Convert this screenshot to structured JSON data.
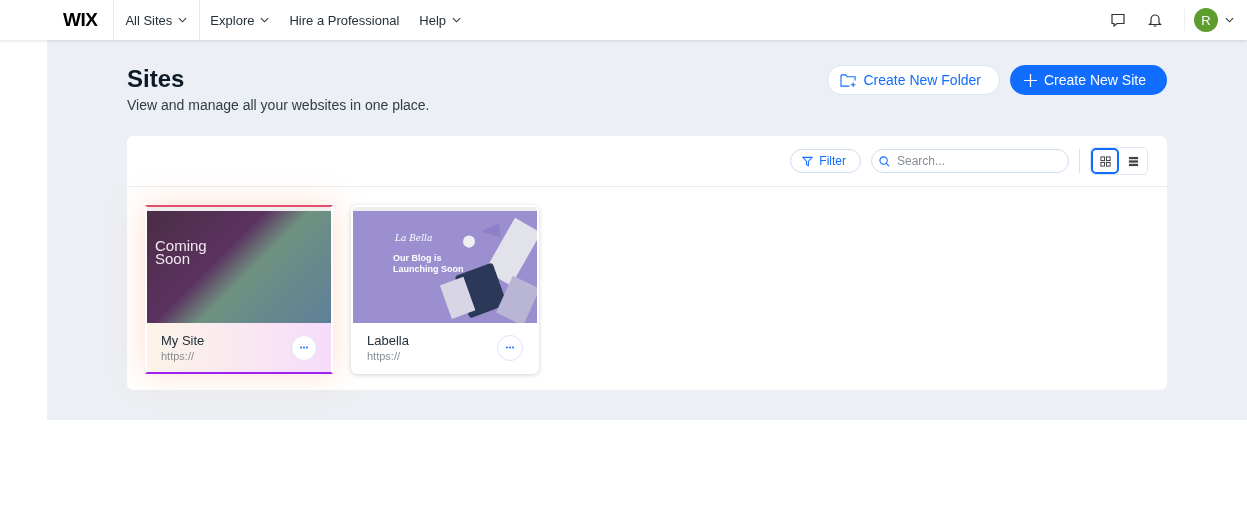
{
  "nav": {
    "logo": "WIX",
    "items": [
      {
        "label": "All Sites",
        "dropdown": true,
        "selected": true
      },
      {
        "label": "Explore",
        "dropdown": true,
        "selected": false
      },
      {
        "label": "Hire a Professional",
        "dropdown": false,
        "selected": false
      },
      {
        "label": "Help",
        "dropdown": true,
        "selected": false
      }
    ],
    "avatar": "R"
  },
  "header": {
    "title": "Sites",
    "subtitle": "View and manage all your websites in one place.",
    "folder_button": "Create New Folder",
    "create_button": "Create New Site"
  },
  "toolbar": {
    "filter": "Filter",
    "search": {
      "placeholder": "Search..."
    },
    "views": [
      {
        "kind": "grid",
        "selected": true
      },
      {
        "kind": "list",
        "selected": false
      }
    ]
  },
  "sites": [
    {
      "name": "My Site",
      "url": "https://",
      "selected": true,
      "preview": {
        "kind": "coming-soon",
        "heading": "Coming Soon"
      }
    },
    {
      "name": "Labella",
      "url": "https://",
      "selected": false,
      "preview": {
        "kind": "blog",
        "logo": "La Bella",
        "heading": "Our Blog is Launching Soon"
      }
    }
  ]
}
